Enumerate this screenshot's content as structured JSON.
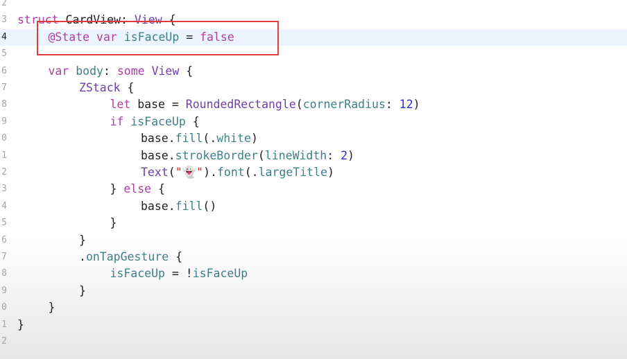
{
  "editor": {
    "lines": [
      {
        "num": "2",
        "indent": 0,
        "tokens": []
      },
      {
        "num": "3",
        "indent": 0,
        "tokens": [
          {
            "t": "struct",
            "c": "kw"
          },
          {
            "t": " ",
            "c": "plain"
          },
          {
            "t": "CardView",
            "c": "plain"
          },
          {
            "t": ": ",
            "c": "plain"
          },
          {
            "t": "View",
            "c": "ty"
          },
          {
            "t": " {",
            "c": "plain"
          }
        ]
      },
      {
        "num": "4",
        "indent": 1,
        "current": true,
        "tokens": [
          {
            "t": "@State",
            "c": "kw"
          },
          {
            "t": " ",
            "c": "plain"
          },
          {
            "t": "var",
            "c": "kw"
          },
          {
            "t": " ",
            "c": "plain"
          },
          {
            "t": "isFaceUp",
            "c": "fn"
          },
          {
            "t": " = ",
            "c": "plain"
          },
          {
            "t": "false",
            "c": "kw"
          }
        ]
      },
      {
        "num": "5",
        "indent": 0,
        "tokens": []
      },
      {
        "num": "6",
        "indent": 1,
        "tokens": [
          {
            "t": "var",
            "c": "kw"
          },
          {
            "t": " ",
            "c": "plain"
          },
          {
            "t": "body",
            "c": "fn"
          },
          {
            "t": ": ",
            "c": "plain"
          },
          {
            "t": "some",
            "c": "kw"
          },
          {
            "t": " ",
            "c": "plain"
          },
          {
            "t": "View",
            "c": "ty"
          },
          {
            "t": " {",
            "c": "plain"
          }
        ]
      },
      {
        "num": "7",
        "indent": 2,
        "tokens": [
          {
            "t": "ZStack",
            "c": "ty"
          },
          {
            "t": " {",
            "c": "plain"
          }
        ]
      },
      {
        "num": "8",
        "indent": 3,
        "tokens": [
          {
            "t": "let",
            "c": "kw"
          },
          {
            "t": " base = ",
            "c": "plain"
          },
          {
            "t": "RoundedRectangle",
            "c": "ty"
          },
          {
            "t": "(",
            "c": "plain"
          },
          {
            "t": "cornerRadius",
            "c": "fn"
          },
          {
            "t": ": ",
            "c": "plain"
          },
          {
            "t": "12",
            "c": "num"
          },
          {
            "t": ")",
            "c": "plain"
          }
        ]
      },
      {
        "num": "9",
        "indent": 3,
        "tokens": [
          {
            "t": "if",
            "c": "kw"
          },
          {
            "t": " ",
            "c": "plain"
          },
          {
            "t": "isFaceUp",
            "c": "fn"
          },
          {
            "t": " {",
            "c": "plain"
          }
        ]
      },
      {
        "num": "0",
        "indent": 4,
        "tokens": [
          {
            "t": "base.",
            "c": "plain"
          },
          {
            "t": "fill",
            "c": "fn"
          },
          {
            "t": "(.",
            "c": "plain"
          },
          {
            "t": "white",
            "c": "fn"
          },
          {
            "t": ")",
            "c": "plain"
          }
        ]
      },
      {
        "num": "1",
        "indent": 4,
        "tokens": [
          {
            "t": "base.",
            "c": "plain"
          },
          {
            "t": "strokeBorder",
            "c": "fn"
          },
          {
            "t": "(",
            "c": "plain"
          },
          {
            "t": "lineWidth",
            "c": "fn"
          },
          {
            "t": ": ",
            "c": "plain"
          },
          {
            "t": "2",
            "c": "num"
          },
          {
            "t": ")",
            "c": "plain"
          }
        ]
      },
      {
        "num": "2",
        "indent": 4,
        "tokens": [
          {
            "t": "Text",
            "c": "ty"
          },
          {
            "t": "(",
            "c": "plain"
          },
          {
            "t": "\"👻\"",
            "c": "str"
          },
          {
            "t": ").",
            "c": "plain"
          },
          {
            "t": "font",
            "c": "fn"
          },
          {
            "t": "(.",
            "c": "plain"
          },
          {
            "t": "largeTitle",
            "c": "fn"
          },
          {
            "t": ")",
            "c": "plain"
          }
        ]
      },
      {
        "num": "3",
        "indent": 3,
        "tokens": [
          {
            "t": "} ",
            "c": "plain"
          },
          {
            "t": "else",
            "c": "kw"
          },
          {
            "t": " {",
            "c": "plain"
          }
        ]
      },
      {
        "num": "4",
        "indent": 4,
        "tokens": [
          {
            "t": "base.",
            "c": "plain"
          },
          {
            "t": "fill",
            "c": "fn"
          },
          {
            "t": "()",
            "c": "plain"
          }
        ]
      },
      {
        "num": "5",
        "indent": 3,
        "tokens": [
          {
            "t": "}",
            "c": "plain"
          }
        ]
      },
      {
        "num": "6",
        "indent": 2,
        "tokens": [
          {
            "t": "}",
            "c": "plain"
          }
        ]
      },
      {
        "num": "7",
        "indent": 2,
        "tokens": [
          {
            "t": ".",
            "c": "plain"
          },
          {
            "t": "onTapGesture",
            "c": "fn"
          },
          {
            "t": " {",
            "c": "plain"
          }
        ]
      },
      {
        "num": "8",
        "indent": 3,
        "tokens": [
          {
            "t": "isFaceUp",
            "c": "fn"
          },
          {
            "t": " = !",
            "c": "plain"
          },
          {
            "t": "isFaceUp",
            "c": "fn"
          }
        ]
      },
      {
        "num": "9",
        "indent": 2,
        "tokens": [
          {
            "t": "}",
            "c": "plain"
          }
        ]
      },
      {
        "num": "0",
        "indent": 1,
        "tokens": [
          {
            "t": "}",
            "c": "plain"
          }
        ]
      },
      {
        "num": "1",
        "indent": 0,
        "tokens": [
          {
            "t": "}",
            "c": "plain"
          }
        ]
      },
      {
        "num": "2",
        "indent": 0,
        "tokens": []
      }
    ]
  },
  "colors": {
    "keyword": "#ad3da4",
    "type": "#703daa",
    "identifier": "#3e8087",
    "number": "#272ad8",
    "string": "#d12f1b",
    "current_line": "#ecf5ff",
    "highlight_box": "#e03a3a"
  }
}
